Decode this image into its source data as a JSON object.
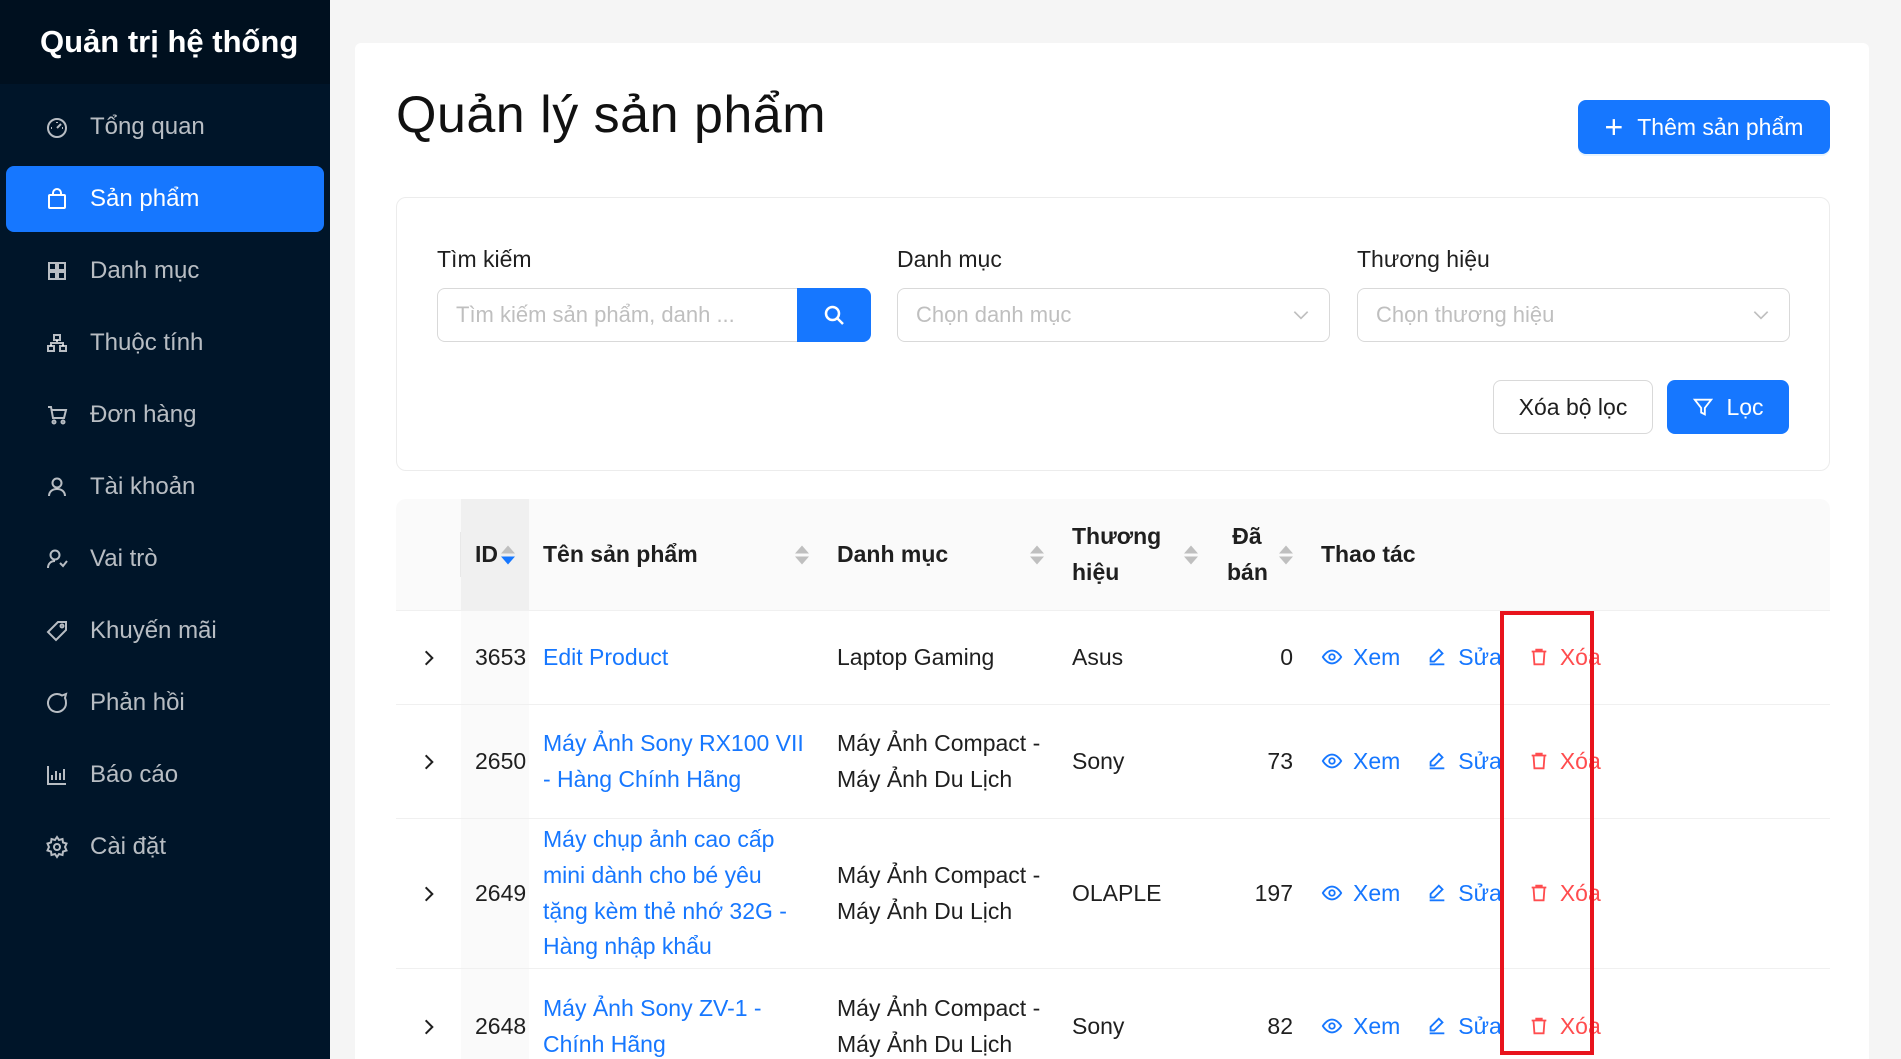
{
  "sidebar": {
    "title": "Quản trị hệ thống",
    "items": [
      {
        "label": "Tổng quan",
        "icon": "dashboard-icon"
      },
      {
        "label": "Sản phẩm",
        "icon": "shopping-bag-icon"
      },
      {
        "label": "Danh mục",
        "icon": "grid-icon"
      },
      {
        "label": "Thuộc tính",
        "icon": "cluster-icon"
      },
      {
        "label": "Đơn hàng",
        "icon": "cart-icon"
      },
      {
        "label": "Tài khoản",
        "icon": "user-icon"
      },
      {
        "label": "Vai trò",
        "icon": "user-switch-icon"
      },
      {
        "label": "Khuyến mãi",
        "icon": "tag-icon"
      },
      {
        "label": "Phản hồi",
        "icon": "message-icon"
      },
      {
        "label": "Báo cáo",
        "icon": "bar-chart-icon"
      },
      {
        "label": "Cài đặt",
        "icon": "setting-icon"
      }
    ],
    "active_index": 1
  },
  "header": {
    "title": "Quản lý sản phẩm",
    "add_button": "Thêm sản phẩm"
  },
  "filters": {
    "search_label": "Tìm kiếm",
    "search_placeholder": "Tìm kiếm sản phẩm, danh ...",
    "category_label": "Danh mục",
    "category_placeholder": "Chọn danh mục",
    "brand_label": "Thương hiệu",
    "brand_placeholder": "Chọn thương hiệu",
    "clear_button": "Xóa bộ lọc",
    "filter_button": "Lọc"
  },
  "table": {
    "columns": {
      "id": "ID",
      "name": "Tên sản phẩm",
      "category": "Danh mục",
      "brand": "Thương hiệu",
      "sold": "Đã bán",
      "actions": "Thao tác"
    },
    "action_labels": {
      "view": "Xem",
      "edit": "Sửa",
      "delete": "Xóa"
    },
    "rows": [
      {
        "id": "3653",
        "name": "Edit Product",
        "category": "Laptop Gaming",
        "brand": "Asus",
        "sold": "0"
      },
      {
        "id": "2650",
        "name": "Máy Ảnh Sony RX100 VII - Hàng Chính Hãng",
        "category": "Máy Ảnh Compact - Máy Ảnh Du Lịch",
        "brand": "Sony",
        "sold": "73"
      },
      {
        "id": "2649",
        "name": "Máy chụp ảnh cao cấp mini dành cho bé yêu tặng kèm thẻ nhớ 32G - Hàng nhập khẩu",
        "category": "Máy Ảnh Compact - Máy Ảnh Du Lịch",
        "brand": "OLAPLE",
        "sold": "197"
      },
      {
        "id": "2648",
        "name": "Máy Ảnh Sony ZV-1 - Chính Hãng",
        "category": "Máy Ảnh Compact - Máy Ảnh Du Lịch",
        "brand": "Sony",
        "sold": "82"
      }
    ]
  },
  "colors": {
    "primary": "#1677ff",
    "danger": "#ff4d4f",
    "sidebar_bg": "#001529",
    "highlight": "#e8131c"
  }
}
